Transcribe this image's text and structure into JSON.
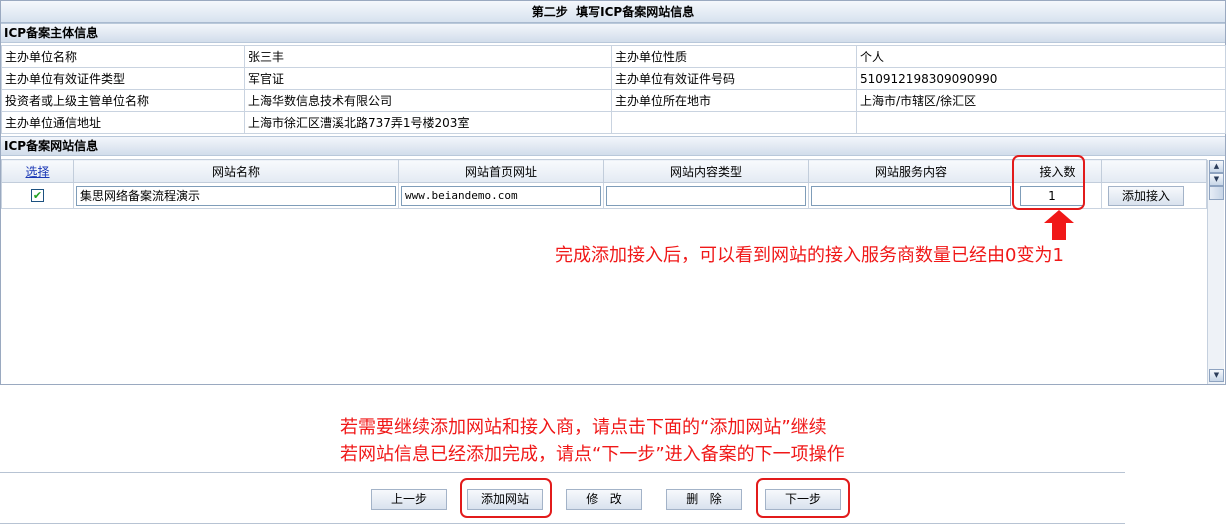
{
  "step_title": "第二步  填写ICP备案网站信息",
  "subject_section": {
    "title": "ICP备案主体信息",
    "rows": [
      {
        "label1": "主办单位名称",
        "value1": "张三丰",
        "label2": "主办单位性质",
        "value2": "个人"
      },
      {
        "label1": "主办单位有效证件类型",
        "value1": "军官证",
        "label2": "主办单位有效证件号码",
        "value2": "510912198309090990"
      },
      {
        "label1": "投资者或上级主管单位名称",
        "value1": "上海华数信息技术有限公司",
        "label2": "主办单位所在地市",
        "value2": "上海市/市辖区/徐汇区"
      },
      {
        "label1": "主办单位通信地址",
        "value1": "上海市徐汇区漕溪北路737弄1号楼203室",
        "label2": "",
        "value2": ""
      }
    ]
  },
  "site_section": {
    "title": "ICP备案网站信息",
    "headers": {
      "select": "选择",
      "name": "网站名称",
      "url": "网站首页网址",
      "content_type": "网站内容类型",
      "service": "网站服务内容",
      "access_count": "接入数"
    },
    "rows": [
      {
        "checked": true,
        "check_glyph": "✔",
        "name": "集思网络备案流程演示",
        "url": "www.beiandemo.com",
        "content_type": "",
        "service": "",
        "access_count": "1",
        "add_access_label": "添加接入"
      }
    ]
  },
  "annotations": {
    "access_note": "完成添加接入后，可以看到网站的接入服务商数量已经由0变为1",
    "continue_note_line1": "若需要继续添加网站和接入商，请点击下面的“添加网站”继续",
    "continue_note_line2": "若网站信息已经添加完成，请点“下一步”进入备案的下一项操作",
    "annotation_color": "#f01818"
  },
  "buttons": {
    "prev": "上一步",
    "add_site": "添加网站",
    "modify": "修   改",
    "delete": "删   除",
    "next": "下一步"
  },
  "colors": {
    "header_gradient_top": "#f5f8fc",
    "header_gradient_bottom": "#d7e2ef",
    "border": "#9aa9c0",
    "link": "#1a37b5",
    "highlight": "#e21b1b"
  }
}
